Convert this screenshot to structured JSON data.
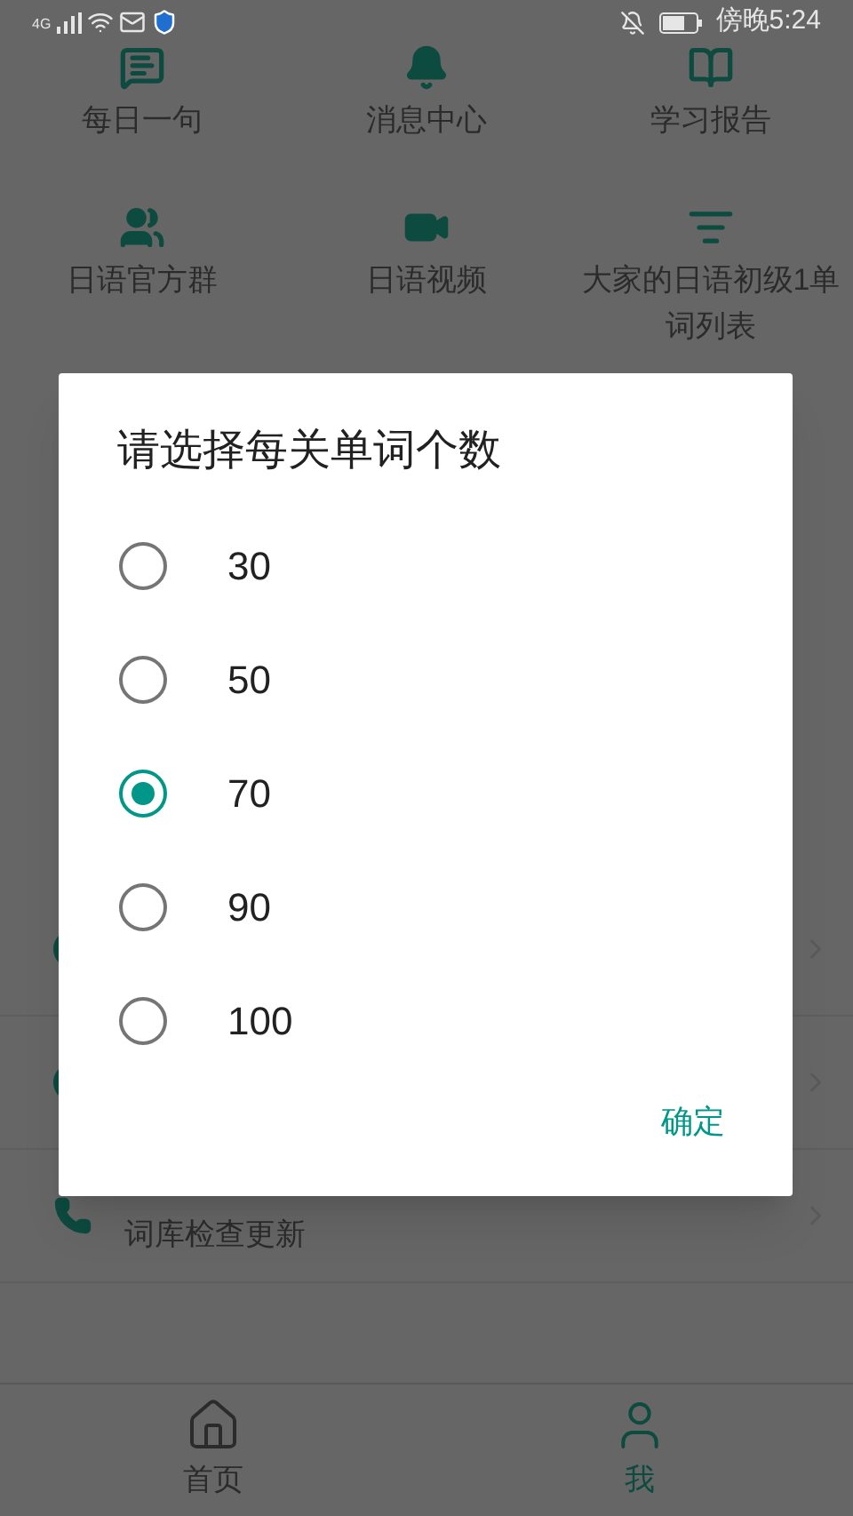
{
  "status_bar": {
    "network": "4G",
    "time": "傍晚5:24"
  },
  "grid": [
    {
      "label": "每日一句",
      "kind": "message"
    },
    {
      "label": "消息中心",
      "kind": "bell"
    },
    {
      "label": "学习报告",
      "kind": "book"
    },
    {
      "label": "日语官方群",
      "kind": "users"
    },
    {
      "label": "日语视频",
      "kind": "video"
    },
    {
      "label": "大家的日语初级1单词列表",
      "kind": "list"
    }
  ],
  "rows": [
    {
      "kind": "dot"
    },
    {
      "kind": "dot"
    },
    {
      "kind": "phone",
      "label": "词库检查更新"
    }
  ],
  "dialog": {
    "title": "请选择每关单词个数",
    "options": [
      {
        "label": "30",
        "selected": false
      },
      {
        "label": "50",
        "selected": false
      },
      {
        "label": "70",
        "selected": true
      },
      {
        "label": "90",
        "selected": false
      },
      {
        "label": "100",
        "selected": false
      }
    ],
    "confirm": "确定"
  },
  "nav": [
    {
      "label": "首页",
      "kind": "home",
      "selected": false
    },
    {
      "label": "我",
      "kind": "person",
      "selected": true
    }
  ]
}
